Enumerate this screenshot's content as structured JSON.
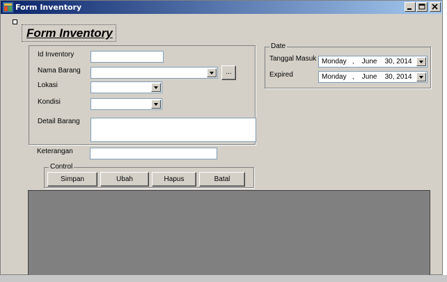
{
  "window": {
    "title": "Form Inventory"
  },
  "heading": "Form Inventory",
  "form": {
    "id_inventory_label": "Id Inventory",
    "nama_barang_label": "Nama Barang",
    "browse_label": "...",
    "lokasi_label": "Lokasi",
    "kondisi_label": "Kondisi",
    "detail_barang_label": "Detail Barang",
    "keterangan_label": "Keterangan"
  },
  "control": {
    "legend": "Control",
    "simpan": "Simpan",
    "ubah": "Ubah",
    "hapus": "Hapus",
    "batal": "Batal"
  },
  "date": {
    "legend": "Date",
    "tanggal_masuk_label": "Tanggal Masuk",
    "tanggal_masuk_value": "Monday   ,    June    30, 2014",
    "expired_label": "Expired",
    "expired_value": "Monday   ,    June    30, 2014"
  }
}
